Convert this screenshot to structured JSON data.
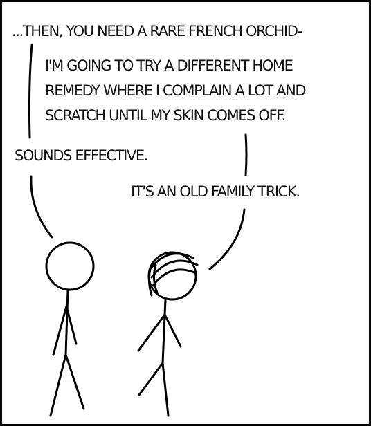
{
  "dialogue": {
    "top_line": "...THEN, YOU NEED A RARE FRENCH ORCHID-",
    "reply_line_1": "I'M GOING TO TRY A DIFFERENT HOME",
    "reply_line_2": "REMEDY WHERE I COMPLAIN A LOT AND",
    "reply_line_3": "SCRATCH UNTIL MY SKIN COMES OFF.",
    "response": "SOUNDS EFFECTIVE.",
    "final_line": "IT'S AN OLD FAMILY TRICK."
  }
}
